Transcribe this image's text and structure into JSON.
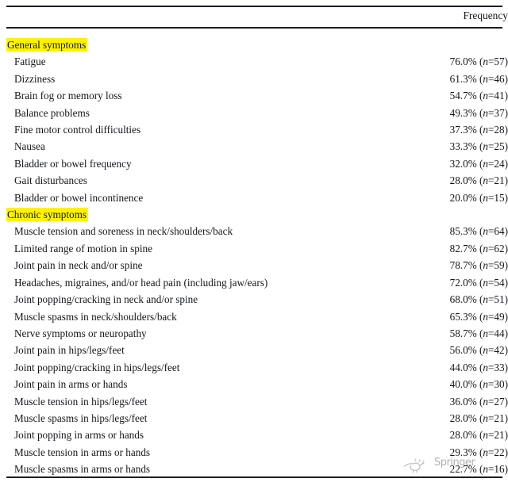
{
  "table": {
    "columns": {
      "label_header": "",
      "frequency_header": "Frequency"
    },
    "sections": [
      {
        "title": "General symptoms",
        "highlight_color": "#FFF200",
        "rows": [
          {
            "label": "Fatigue",
            "percent": "76.0%",
            "n": "57"
          },
          {
            "label": "Dizziness",
            "percent": "61.3%",
            "n": "46"
          },
          {
            "label": "Brain fog or memory loss",
            "percent": "54.7%",
            "n": "41"
          },
          {
            "label": "Balance problems",
            "percent": "49.3%",
            "n": "37"
          },
          {
            "label": "Fine motor control difficulties",
            "percent": "37.3%",
            "n": "28"
          },
          {
            "label": "Nausea",
            "percent": "33.3%",
            "n": "25"
          },
          {
            "label": "Bladder or bowel frequency",
            "percent": "32.0%",
            "n": "24"
          },
          {
            "label": "Gait disturbances",
            "percent": "28.0%",
            "n": "21"
          },
          {
            "label": "Bladder or bowel incontinence",
            "percent": "20.0%",
            "n": "15"
          }
        ]
      },
      {
        "title": "Chronic symptoms",
        "highlight_color": "#FFF200",
        "rows": [
          {
            "label": "Muscle tension and soreness in neck/shoulders/back",
            "percent": "85.3%",
            "n": "64"
          },
          {
            "label": "Limited range of motion in spine",
            "percent": "82.7%",
            "n": "62"
          },
          {
            "label": "Joint pain in neck and/or spine",
            "percent": "78.7%",
            "n": "59"
          },
          {
            "label": "Headaches, migraines, and/or head pain (including jaw/ears)",
            "percent": "72.0%",
            "n": "54"
          },
          {
            "label": "Joint popping/cracking in neck and/or spine",
            "percent": "68.0%",
            "n": "51"
          },
          {
            "label": "Muscle spasms in neck/shoulders/back",
            "percent": "65.3%",
            "n": "49"
          },
          {
            "label": "Nerve symptoms or neuropathy",
            "percent": "58.7%",
            "n": "44"
          },
          {
            "label": "Joint pain in hips/legs/feet",
            "percent": "56.0%",
            "n": "42"
          },
          {
            "label": "Joint popping/cracking in hips/legs/feet",
            "percent": "44.0%",
            "n": "33"
          },
          {
            "label": "Joint pain in arms or hands",
            "percent": "40.0%",
            "n": "30"
          },
          {
            "label": "Muscle tension in hips/legs/feet",
            "percent": "36.0%",
            "n": "27"
          },
          {
            "label": "Muscle spasms in hips/legs/feet",
            "percent": "28.0%",
            "n": "21"
          },
          {
            "label": "Joint popping in arms or hands",
            "percent": "28.0%",
            "n": "21"
          },
          {
            "label": "Muscle tension in arms or hands",
            "percent": "29.3%",
            "n": "22"
          },
          {
            "label": "Muscle spasms in arms or hands",
            "percent": "22.7%",
            "n": "16"
          }
        ]
      }
    ]
  },
  "watermark": {
    "text": "Springer",
    "icon": "bird-logo-icon"
  }
}
